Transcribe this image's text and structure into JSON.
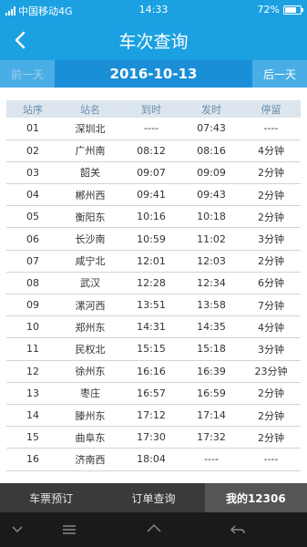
{
  "status_bar": {
    "carrier": "中国移动4G",
    "time": "14:33",
    "battery": "72%",
    "battery_level": 0.72
  },
  "header": {
    "title": "车次查询"
  },
  "date_bar": {
    "prev_label": "前一天",
    "date": "2016-10-13",
    "next_label": "后一天"
  },
  "table": {
    "headers": [
      "站序",
      "站名",
      "到时",
      "发时",
      "停留"
    ],
    "rows": [
      [
        "01",
        "深圳北",
        "----",
        "07:43",
        "----"
      ],
      [
        "02",
        "广州南",
        "08:12",
        "08:16",
        "4分钟"
      ],
      [
        "03",
        "韶关",
        "09:07",
        "09:09",
        "2分钟"
      ],
      [
        "04",
        "郴州西",
        "09:41",
        "09:43",
        "2分钟"
      ],
      [
        "05",
        "衡阳东",
        "10:16",
        "10:18",
        "2分钟"
      ],
      [
        "06",
        "长沙南",
        "10:59",
        "11:02",
        "3分钟"
      ],
      [
        "07",
        "咸宁北",
        "12:01",
        "12:03",
        "2分钟"
      ],
      [
        "08",
        "武汉",
        "12:28",
        "12:34",
        "6分钟"
      ],
      [
        "09",
        "漯河西",
        "13:51",
        "13:58",
        "7分钟"
      ],
      [
        "10",
        "郑州东",
        "14:31",
        "14:35",
        "4分钟"
      ],
      [
        "11",
        "民权北",
        "15:15",
        "15:18",
        "3分钟"
      ],
      [
        "12",
        "徐州东",
        "16:16",
        "16:39",
        "23分钟"
      ],
      [
        "13",
        "枣庄",
        "16:57",
        "16:59",
        "2分钟"
      ],
      [
        "14",
        "滕州东",
        "17:12",
        "17:14",
        "2分钟"
      ],
      [
        "15",
        "曲阜东",
        "17:30",
        "17:32",
        "2分钟"
      ],
      [
        "16",
        "济南西",
        "18:04",
        "----",
        "----"
      ]
    ]
  },
  "bottom_nav": {
    "items": [
      {
        "label": "车票预订"
      },
      {
        "label": "订单查询"
      },
      {
        "label": "我的12306"
      }
    ]
  },
  "icons": {
    "back": "back-arrow-icon",
    "menu": "menu-icon",
    "home": "home-icon",
    "back_system": "system-back-icon"
  },
  "colors": {
    "accent": "#1ba1e2",
    "header_row": "#dde5ee",
    "nav_bg": "#3a3a3a"
  }
}
